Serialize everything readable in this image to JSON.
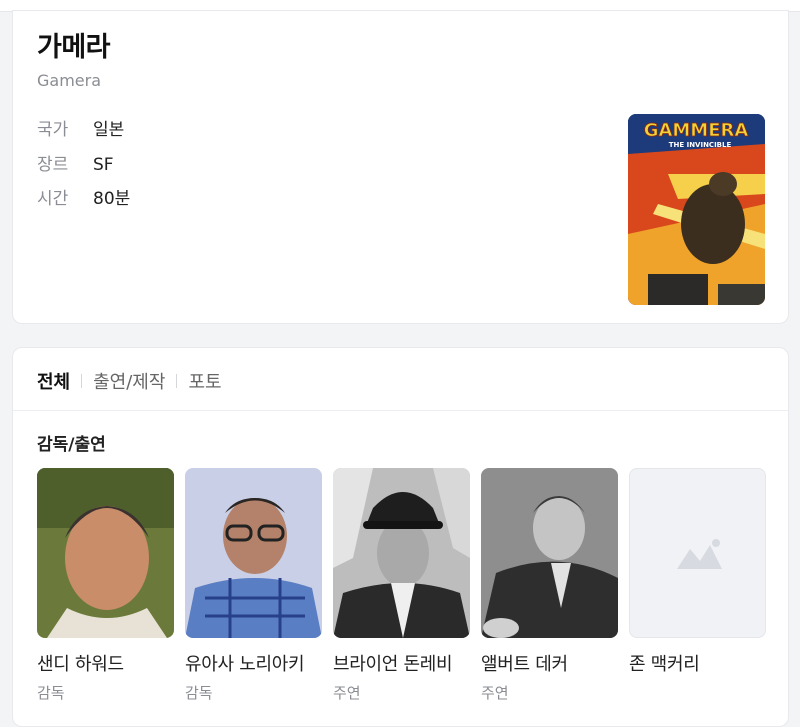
{
  "movie": {
    "title": "가메라",
    "original_title": "Gamera",
    "meta": [
      {
        "label": "국가",
        "value": "일본"
      },
      {
        "label": "장르",
        "value": "SF"
      },
      {
        "label": "시간",
        "value": "80분"
      }
    ],
    "poster_title": "GAMMERA",
    "poster_subtitle": "THE INVINCIBLE"
  },
  "tabs": {
    "all": "전체",
    "cast": "출연/제작",
    "photo": "포토"
  },
  "cast_section": {
    "title": "감독/출연",
    "people": [
      {
        "name": "샌디 하워드",
        "role": "감독"
      },
      {
        "name": "유아사 노리아키",
        "role": "감독"
      },
      {
        "name": "브라이언 돈레비",
        "role": "주연"
      },
      {
        "name": "앨버트 데커",
        "role": "주연"
      },
      {
        "name": "존 맥커리",
        "role": ""
      }
    ]
  }
}
